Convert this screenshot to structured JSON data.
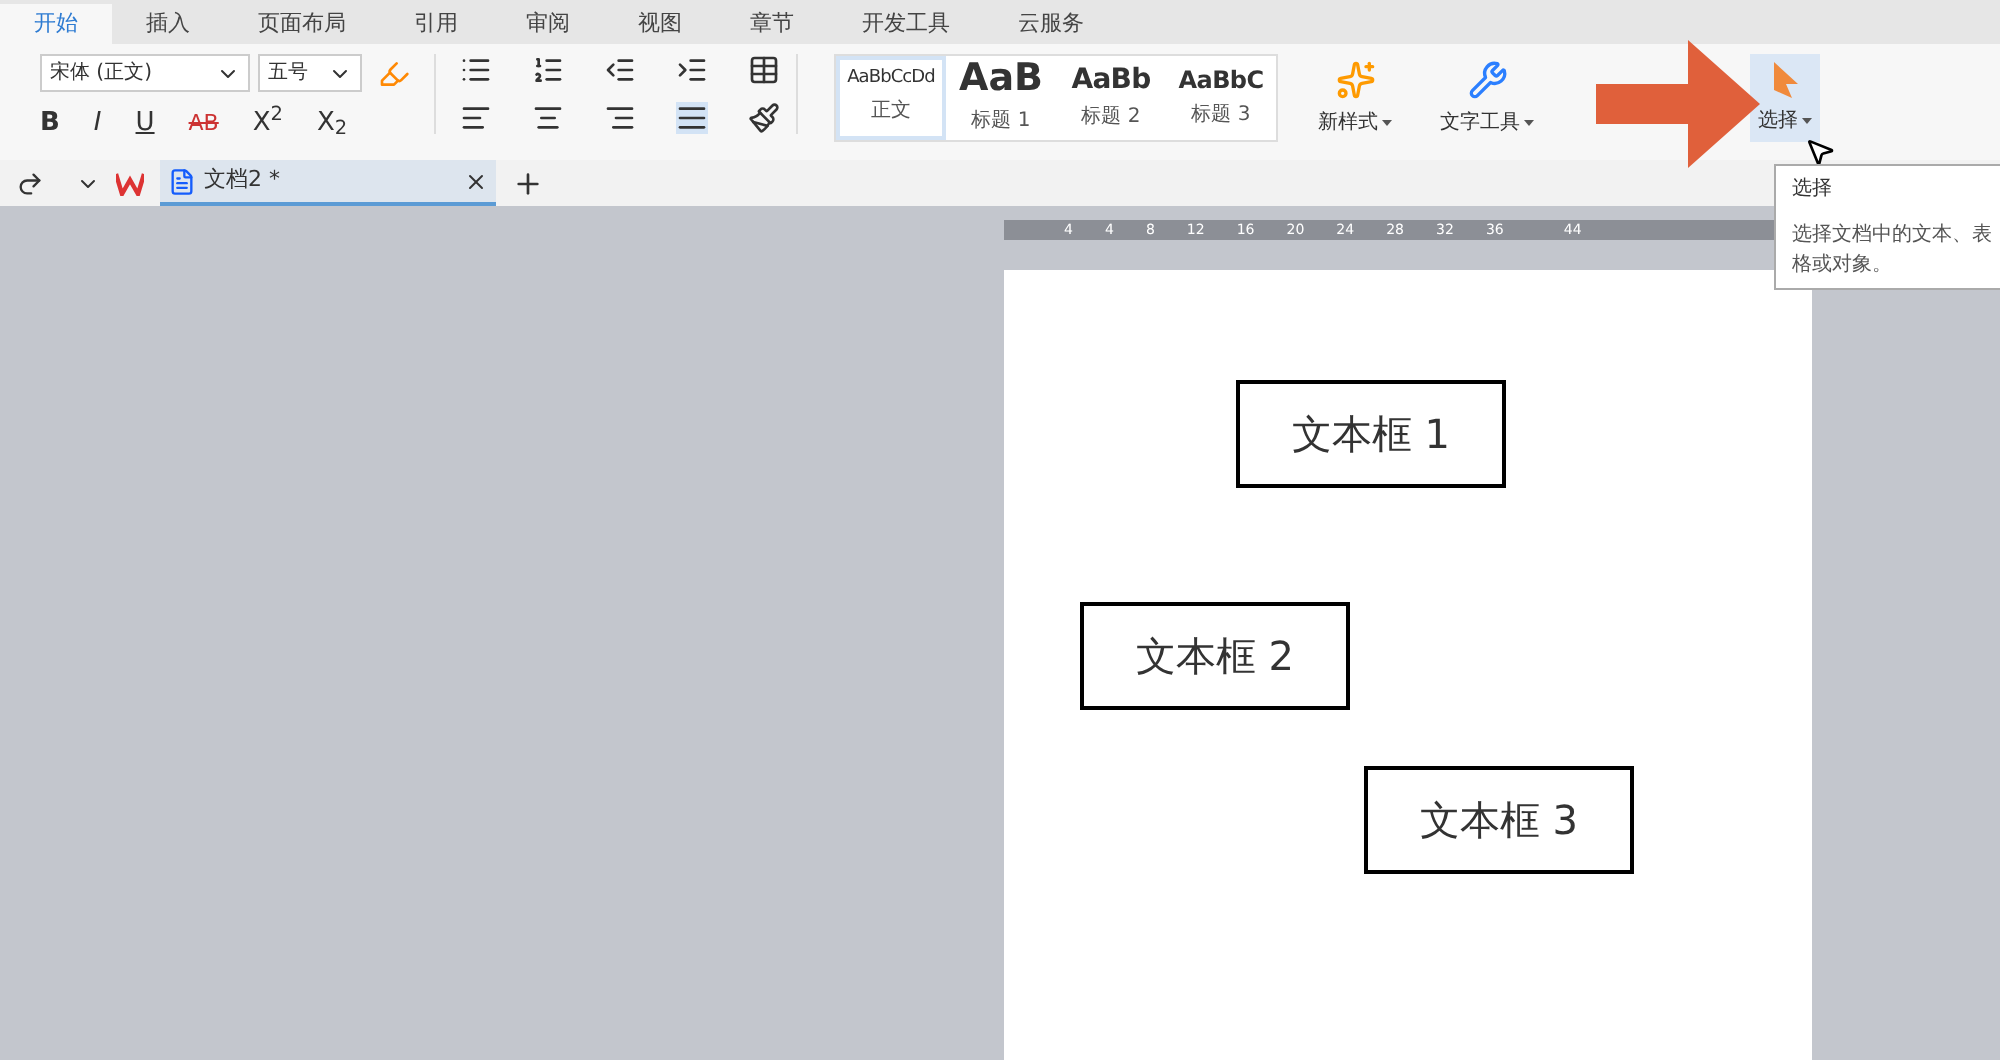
{
  "tabs": [
    {
      "label": "开始",
      "selected": true
    },
    {
      "label": "插入",
      "selected": false
    },
    {
      "label": "页面布局",
      "selected": false
    },
    {
      "label": "引用",
      "selected": false
    },
    {
      "label": "审阅",
      "selected": false
    },
    {
      "label": "视图",
      "selected": false
    },
    {
      "label": "章节",
      "selected": false
    },
    {
      "label": "开发工具",
      "selected": false
    },
    {
      "label": "云服务",
      "selected": false
    }
  ],
  "font": {
    "family": "宋体 (正文)",
    "size": "五号"
  },
  "format_buttons": [
    "B",
    "I",
    "U",
    "AB",
    "X$^{2}$",
    "X$_{2}$"
  ],
  "styles": [
    {
      "sample": "AaBbCcDd",
      "label": "正文",
      "selected": true,
      "kind": "normal"
    },
    {
      "sample": "AaB",
      "label": "标题 1",
      "selected": false,
      "kind": "h1"
    },
    {
      "sample": "AaBb",
      "label": "标题 2",
      "selected": false,
      "kind": "h2"
    },
    {
      "sample": "AaBbC",
      "label": "标题 3",
      "selected": false,
      "kind": "h3"
    }
  ],
  "big_buttons": [
    {
      "label": "新样式",
      "kind": "styles",
      "hovered": false
    },
    {
      "label": "文字工具",
      "kind": "tools",
      "hovered": false
    },
    {
      "label": "选择",
      "kind": "select",
      "hovered": true
    }
  ],
  "doc_tab": {
    "title": "文档2 *"
  },
  "ruler": [
    "4",
    "4",
    "8",
    "12",
    "16",
    "20",
    "24",
    "28",
    "32",
    "36",
    "44"
  ],
  "text_boxes": [
    "文本框 1",
    "文本框 2",
    "文本框 3"
  ],
  "tooltip": {
    "title": "选择",
    "body": [
      "选择文档中的文本、表",
      "格或对象。"
    ]
  }
}
